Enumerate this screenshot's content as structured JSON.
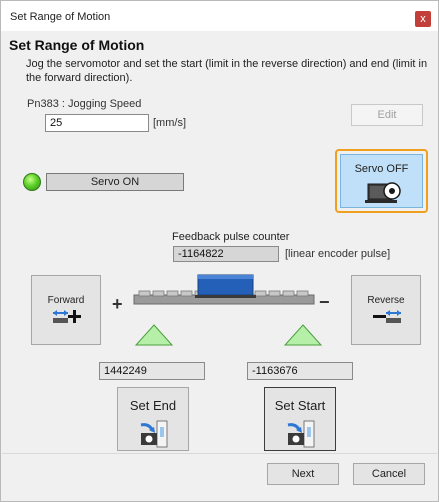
{
  "window": {
    "title": "Set Range of Motion",
    "close_glyph": "x"
  },
  "heading": "Set Range of Motion",
  "description": "Jog the servomotor and set the start (limit in the reverse direction) and end (limit in the forward direction).",
  "jog_speed": {
    "label": "Pn383 : Jogging Speed",
    "value": "25",
    "unit": "[mm/s]",
    "edit_label": "Edit"
  },
  "servo": {
    "status_led_color": "#5fd12a",
    "on_label": "Servo ON",
    "off_label": "Servo OFF",
    "off_icon": "servo-motor-icon",
    "off_highlight": "#f0a020"
  },
  "feedback": {
    "label": "Feedback pulse counter",
    "value": "-1164822",
    "unit": "[linear encoder pulse]"
  },
  "jog": {
    "forward_label": "Forward",
    "reverse_label": "Reverse",
    "plus": "+",
    "minus": "−"
  },
  "positions": {
    "end_value": "1442249",
    "start_value": "-1163676"
  },
  "set_buttons": {
    "end_label": "Set End",
    "start_label": "Set Start"
  },
  "footer": {
    "next_label": "Next",
    "cancel_label": "Cancel"
  },
  "colors": {
    "slider_blue": "#2460b8",
    "marker_green": "#b6f0a8",
    "arrow_blue": "#2c78d4"
  }
}
